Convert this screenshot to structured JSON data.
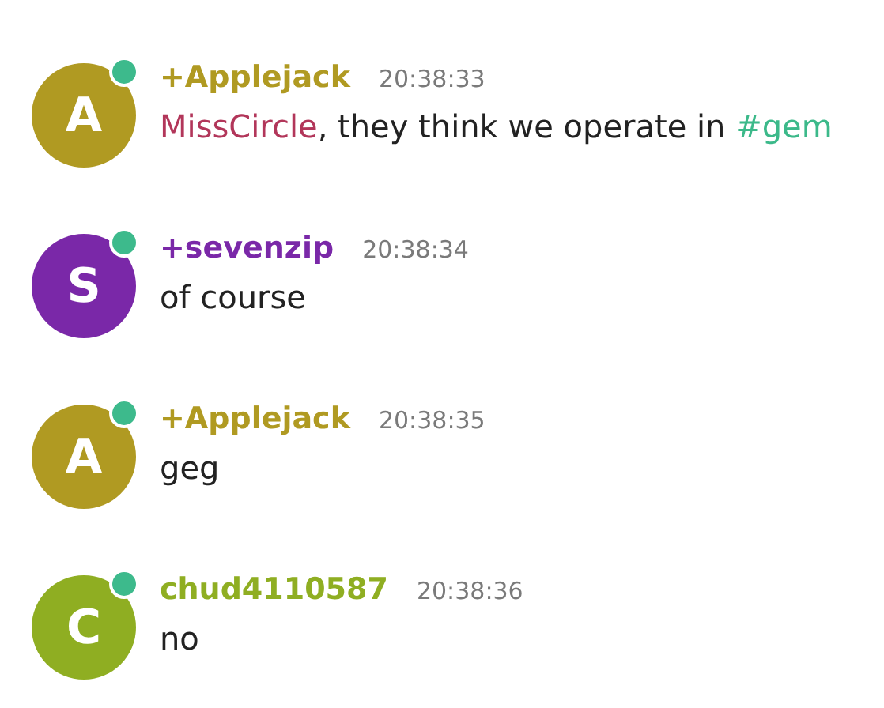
{
  "messages": [
    {
      "initial": "A",
      "author": "+Applejack",
      "color": "#b09a22",
      "online": true,
      "time": "20:38:33",
      "text": [
        {
          "kind": "mention",
          "text": "MissCircle"
        },
        {
          "kind": "plain",
          "text": ", they think we operate in "
        },
        {
          "kind": "channel",
          "text": "#gem"
        }
      ]
    },
    {
      "initial": "S",
      "author": "+sevenzip",
      "color": "#7a28a8",
      "online": true,
      "time": "20:38:34",
      "text": [
        {
          "kind": "plain",
          "text": "of course"
        }
      ]
    },
    {
      "initial": "A",
      "author": "+Applejack",
      "color": "#b09a22",
      "online": true,
      "time": "20:38:35",
      "text": [
        {
          "kind": "plain",
          "text": "geg"
        }
      ]
    },
    {
      "initial": "C",
      "author": "chud4110587",
      "color": "#8fae22",
      "online": true,
      "time": "20:38:36",
      "text": [
        {
          "kind": "plain",
          "text": "no"
        }
      ]
    }
  ]
}
